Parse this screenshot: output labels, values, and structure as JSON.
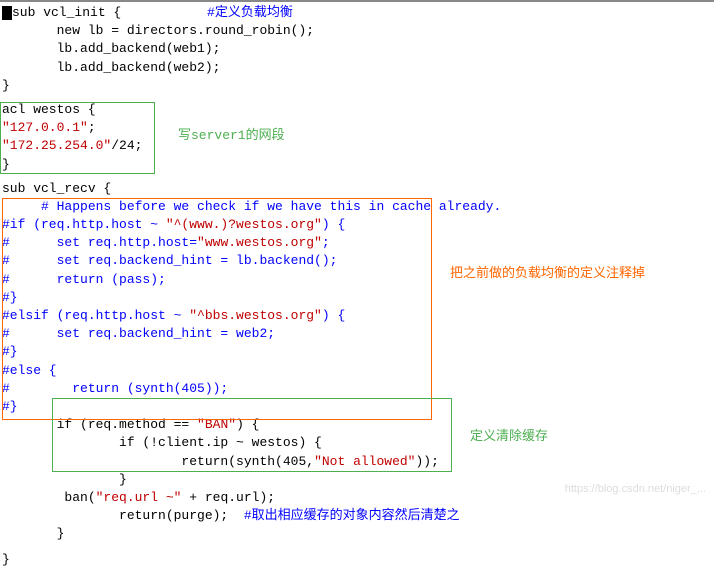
{
  "code": {
    "l1": "sub vcl_init {           ",
    "l1_comment": "#定义负载均衡",
    "l2": "       new lb = directors.round_robin();",
    "l3": "       lb.add_backend(web1);",
    "l4": "       lb.add_backend(web2);",
    "l5": "}",
    "acl_l1": "acl westos {",
    "acl_l2_str": "\"127.0.0.1\"",
    "acl_l2_after": ";",
    "acl_l3_str": "\"172.25.254.0\"",
    "acl_l3_after": "/24;",
    "acl_l4": "}",
    "recv_l1": "sub vcl_recv {",
    "recv_c1": "     # Happens before we check if we have this in cache already.",
    "recv_c2a": "#if (req.http.host ~ ",
    "recv_c2b": "\"^(www.)?westos.org\"",
    "recv_c2c": ") {",
    "recv_c3a": "#      set req.http.host=",
    "recv_c3b": "\"www.westos.org\"",
    "recv_c3c": ";",
    "recv_c4": "#      set req.backend_hint = lb.backend();",
    "recv_c5": "#      return (pass);",
    "recv_c6": "#}",
    "recv_c7a": "#elsif (req.http.host ~ ",
    "recv_c7b": "\"^bbs.westos.org\"",
    "recv_c7c": ") {",
    "recv_c8": "#      set req.backend_hint = web2;",
    "recv_c9": "#}",
    "recv_c10": "#else {",
    "recv_c11": "#        return (synth(405));",
    "recv_c12": "#}",
    "ban_l1a": "       if (req.method == ",
    "ban_l1b": "\"BAN\"",
    "ban_l1c": ") {",
    "ban_l2": "               if (!client.ip ~ westos) {",
    "ban_l3a": "                       return(synth(405,",
    "ban_l3b": "\"Not allowed\"",
    "ban_l3c": "));",
    "ban_l4": "               }",
    "ban_l5a": "        ban(",
    "ban_l5b": "\"req.url ~\"",
    "ban_l5c": " + req.url);",
    "ban_l6a": "               return(purge);  ",
    "ban_l6b": "#取出相应缓存的对象内容然后清楚之",
    "ban_l7": "       }",
    "recv_end": "}"
  },
  "annotations": {
    "a1": "写server1的网段",
    "a2": "把之前做的负载均衡的定义注释掉",
    "a3": "定义清除缓存"
  },
  "watermark": "https://blog.csdn.net/niger_..."
}
